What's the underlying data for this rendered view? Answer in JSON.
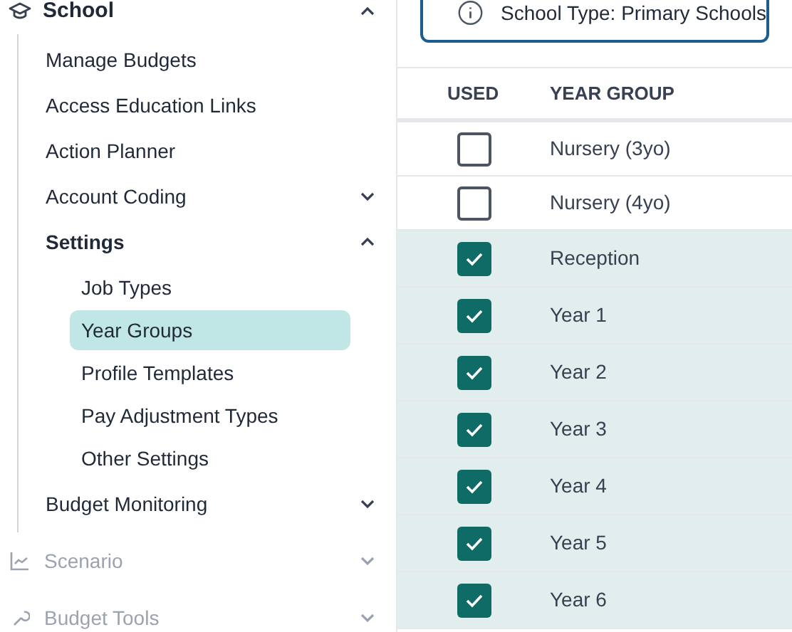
{
  "sidebar": {
    "section": {
      "label": "School",
      "expanded": true
    },
    "items": [
      {
        "label": "Manage Budgets",
        "selected": false
      },
      {
        "label": "Access Education Links",
        "selected": false
      },
      {
        "label": "Action Planner",
        "selected": false
      },
      {
        "label": "Account Coding",
        "selected": false,
        "expanded": false
      },
      {
        "label": "Settings",
        "selected": false,
        "expanded": true,
        "children": [
          {
            "label": "Job Types",
            "selected": false
          },
          {
            "label": "Year Groups",
            "selected": true
          },
          {
            "label": "Profile Templates",
            "selected": false
          },
          {
            "label": "Pay Adjustment Types",
            "selected": false
          },
          {
            "label": "Other Settings",
            "selected": false
          }
        ]
      },
      {
        "label": "Budget Monitoring",
        "selected": false,
        "expanded": false
      }
    ],
    "other_sections": [
      {
        "label": "Scenario",
        "expanded": false,
        "disabled": true
      },
      {
        "label": "Budget Tools",
        "expanded": false,
        "disabled": true
      }
    ]
  },
  "info_banner": {
    "text": "School Type: Primary Schools"
  },
  "table": {
    "columns": [
      "USED",
      "YEAR GROUP"
    ],
    "rows": [
      {
        "used": false,
        "year_group": "Nursery (3yo)"
      },
      {
        "used": false,
        "year_group": "Nursery (4yo)"
      },
      {
        "used": true,
        "year_group": "Reception"
      },
      {
        "used": true,
        "year_group": "Year 1"
      },
      {
        "used": true,
        "year_group": "Year 2"
      },
      {
        "used": true,
        "year_group": "Year 3"
      },
      {
        "used": true,
        "year_group": "Year 4"
      },
      {
        "used": true,
        "year_group": "Year 5"
      },
      {
        "used": true,
        "year_group": "Year 6"
      }
    ]
  }
}
